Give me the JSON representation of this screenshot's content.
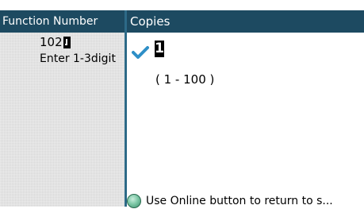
{
  "left_panel": {
    "header": "Function Number",
    "value": "102",
    "hint": "Enter 1-3digit"
  },
  "right_panel": {
    "header": "Copies",
    "selected_icon": "checkmark-icon",
    "copies_value": "1",
    "range": "( 1 - 100 )"
  },
  "footer": {
    "icon": "online-button-icon",
    "text": "Use Online button to return to s..."
  },
  "colors": {
    "header_bg": "#1d4a61",
    "divider": "#2d6a87",
    "check": "#2e8fc7",
    "left_bg": "#d6d6d6"
  }
}
